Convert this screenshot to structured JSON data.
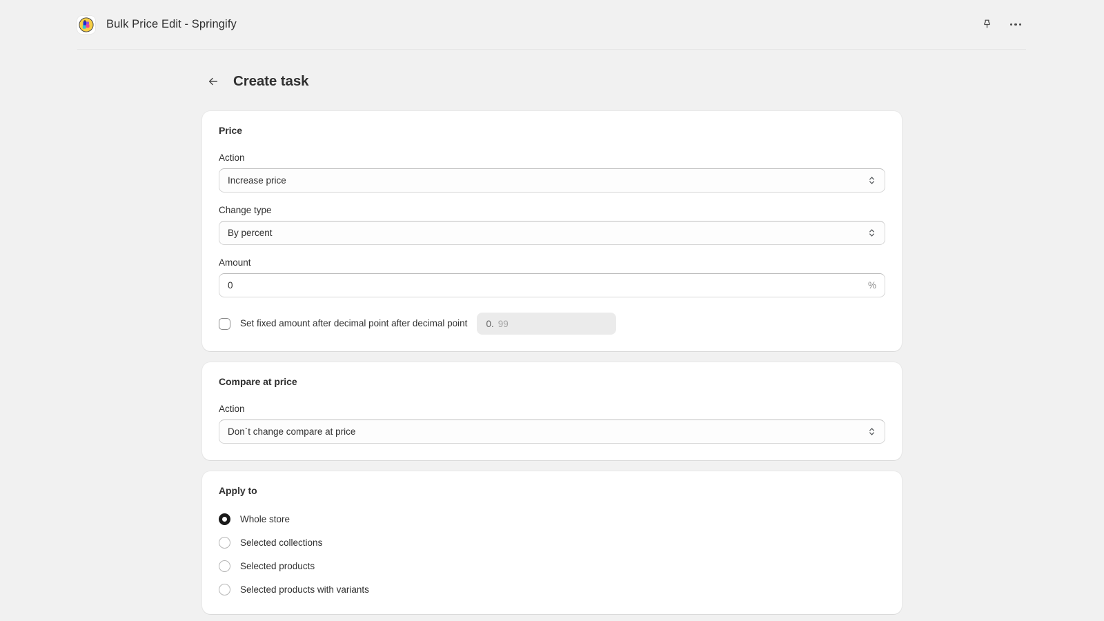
{
  "appbar": {
    "app_name": "Bulk Price Edit - Springify",
    "app_icon": "springify-app-icon",
    "pin_icon": "pin-icon",
    "more_icon": "more-horizontal-icon"
  },
  "page": {
    "back_icon": "arrow-left-icon",
    "title": "Create task"
  },
  "price_card": {
    "title": "Price",
    "action": {
      "label": "Action",
      "value": "Increase price",
      "icon": "select-chevron-updown-icon"
    },
    "change_type": {
      "label": "Change type",
      "value": "By percent",
      "icon": "select-chevron-updown-icon"
    },
    "amount": {
      "label": "Amount",
      "value": "0",
      "suffix": "%"
    },
    "fixed_decimal": {
      "checked": false,
      "label": "Set fixed amount after decimal point after decimal point",
      "prefix": "0.",
      "placeholder": "99",
      "disabled": true
    }
  },
  "compare_card": {
    "title": "Compare at price",
    "action": {
      "label": "Action",
      "value": "Don`t change compare at price",
      "icon": "select-chevron-updown-icon"
    }
  },
  "apply_card": {
    "title": "Apply to",
    "selected": "Whole store",
    "options": [
      {
        "label": "Whole store",
        "checked": true
      },
      {
        "label": "Selected collections",
        "checked": false
      },
      {
        "label": "Selected products",
        "checked": false
      },
      {
        "label": "Selected products with variants",
        "checked": false
      }
    ]
  },
  "colors": {
    "background": "#f1f1f1",
    "card": "#ffffff",
    "text": "#303030",
    "muted": "#8a8a8a",
    "border": "#d6d6d6",
    "radio_selected": "#1a1a1a"
  }
}
